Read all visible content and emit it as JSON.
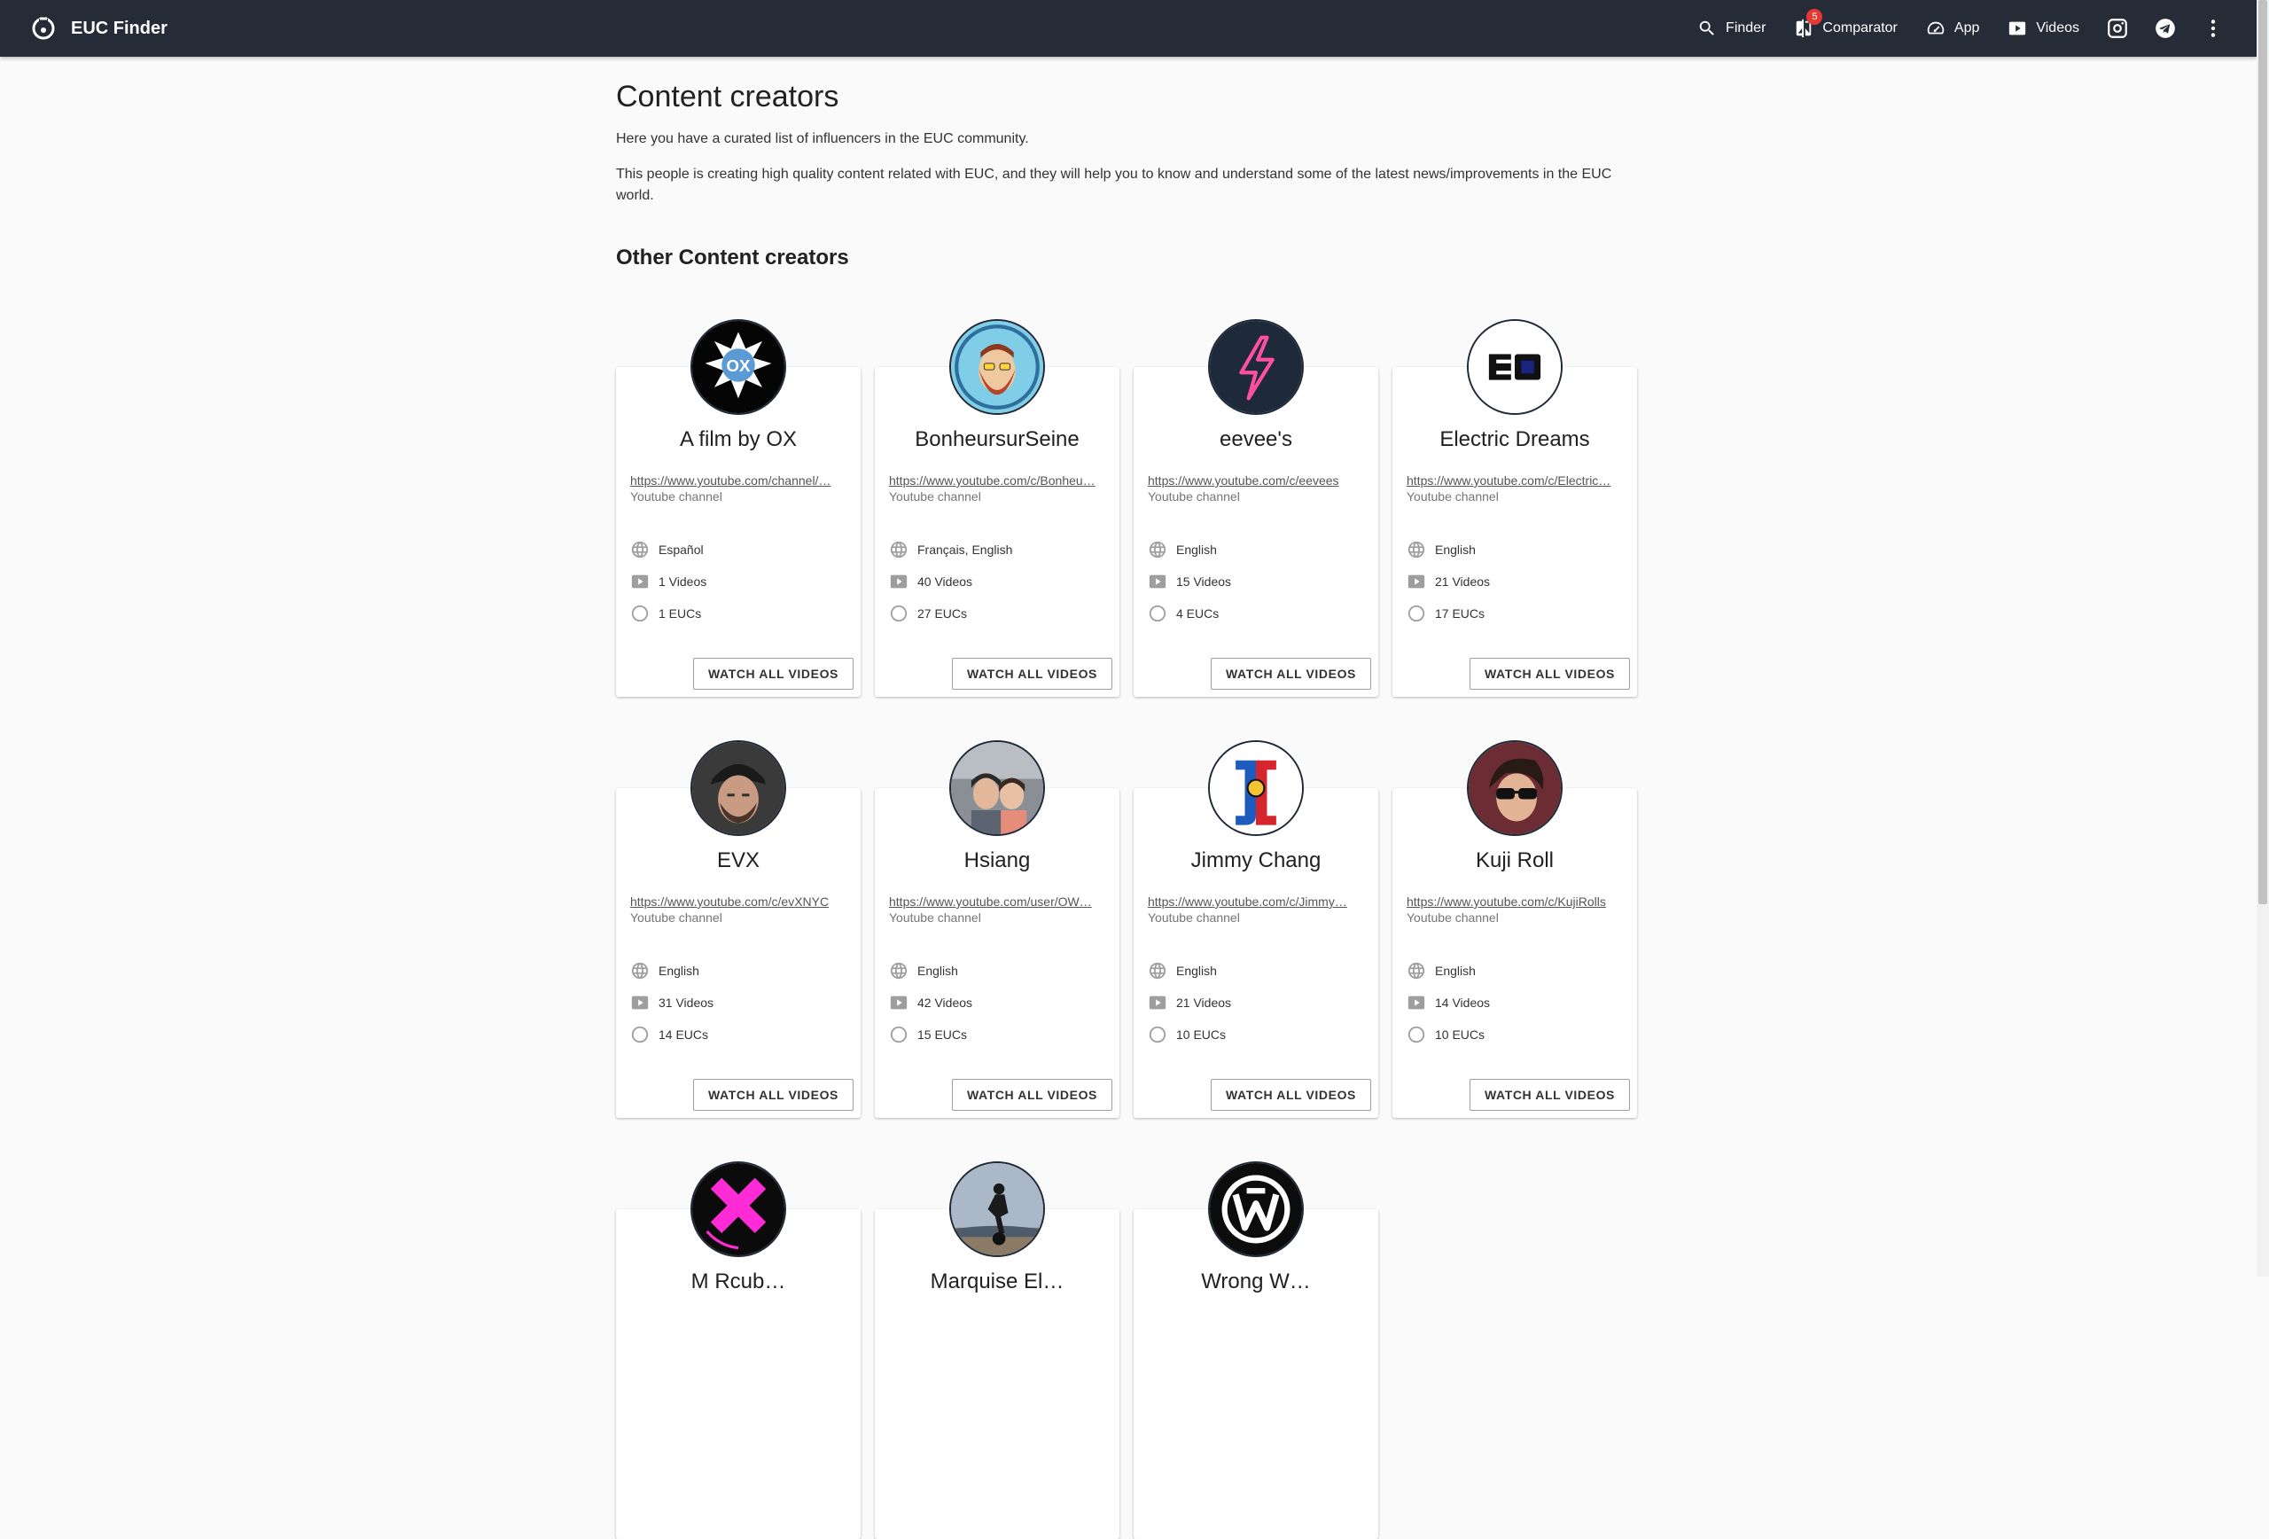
{
  "app": {
    "title": "EUC Finder",
    "nav": {
      "finder": "Finder",
      "comparator": "Comparator",
      "comparator_badge": "5",
      "app": "App",
      "videos": "Videos"
    }
  },
  "page": {
    "title": "Content creators",
    "intro": "Here you have a curated list of influencers in the EUC community.",
    "intro2": "This people is creating high quality content related with EUC, and they will help you to know and understand some of the latest news/improvements in the EUC world.",
    "section_title": "Other Content creators"
  },
  "labels": {
    "watch_all": "WATCH ALL VIDEOS",
    "channel_type": "Youtube channel"
  },
  "creators": [
    {
      "name": "A film by OX",
      "url": "https://www.youtube.com/channel/…",
      "language": "Español",
      "videos": "1 Videos",
      "eucs": "1 EUCs"
    },
    {
      "name": "BonheursurSeine",
      "url": "https://www.youtube.com/c/Bonheu…",
      "language": "Français, English",
      "videos": "40 Videos",
      "eucs": "27 EUCs"
    },
    {
      "name": "eevee's",
      "url": "https://www.youtube.com/c/eevees",
      "language": "English",
      "videos": "15 Videos",
      "eucs": "4 EUCs"
    },
    {
      "name": "Electric Dreams",
      "url": "https://www.youtube.com/c/Electric…",
      "language": "English",
      "videos": "21 Videos",
      "eucs": "17 EUCs"
    },
    {
      "name": "EVX",
      "url": "https://www.youtube.com/c/evXNYC",
      "language": "English",
      "videos": "31 Videos",
      "eucs": "14 EUCs"
    },
    {
      "name": "Hsiang",
      "url": "https://www.youtube.com/user/OW…",
      "language": "English",
      "videos": "42 Videos",
      "eucs": "15 EUCs"
    },
    {
      "name": "Jimmy Chang",
      "url": "https://www.youtube.com/c/Jimmy…",
      "language": "English",
      "videos": "21 Videos",
      "eucs": "10 EUCs"
    },
    {
      "name": "Kuji Roll",
      "url": "https://www.youtube.com/c/KujiRolls",
      "language": "English",
      "videos": "14 Videos",
      "eucs": "10 EUCs"
    },
    {
      "name": "M Rcub…",
      "url": "",
      "language": "",
      "videos": "",
      "eucs": ""
    },
    {
      "name": "Marquise El…",
      "url": "",
      "language": "",
      "videos": "",
      "eucs": ""
    },
    {
      "name": "Wrong W…",
      "url": "",
      "language": "",
      "videos": "",
      "eucs": ""
    }
  ]
}
